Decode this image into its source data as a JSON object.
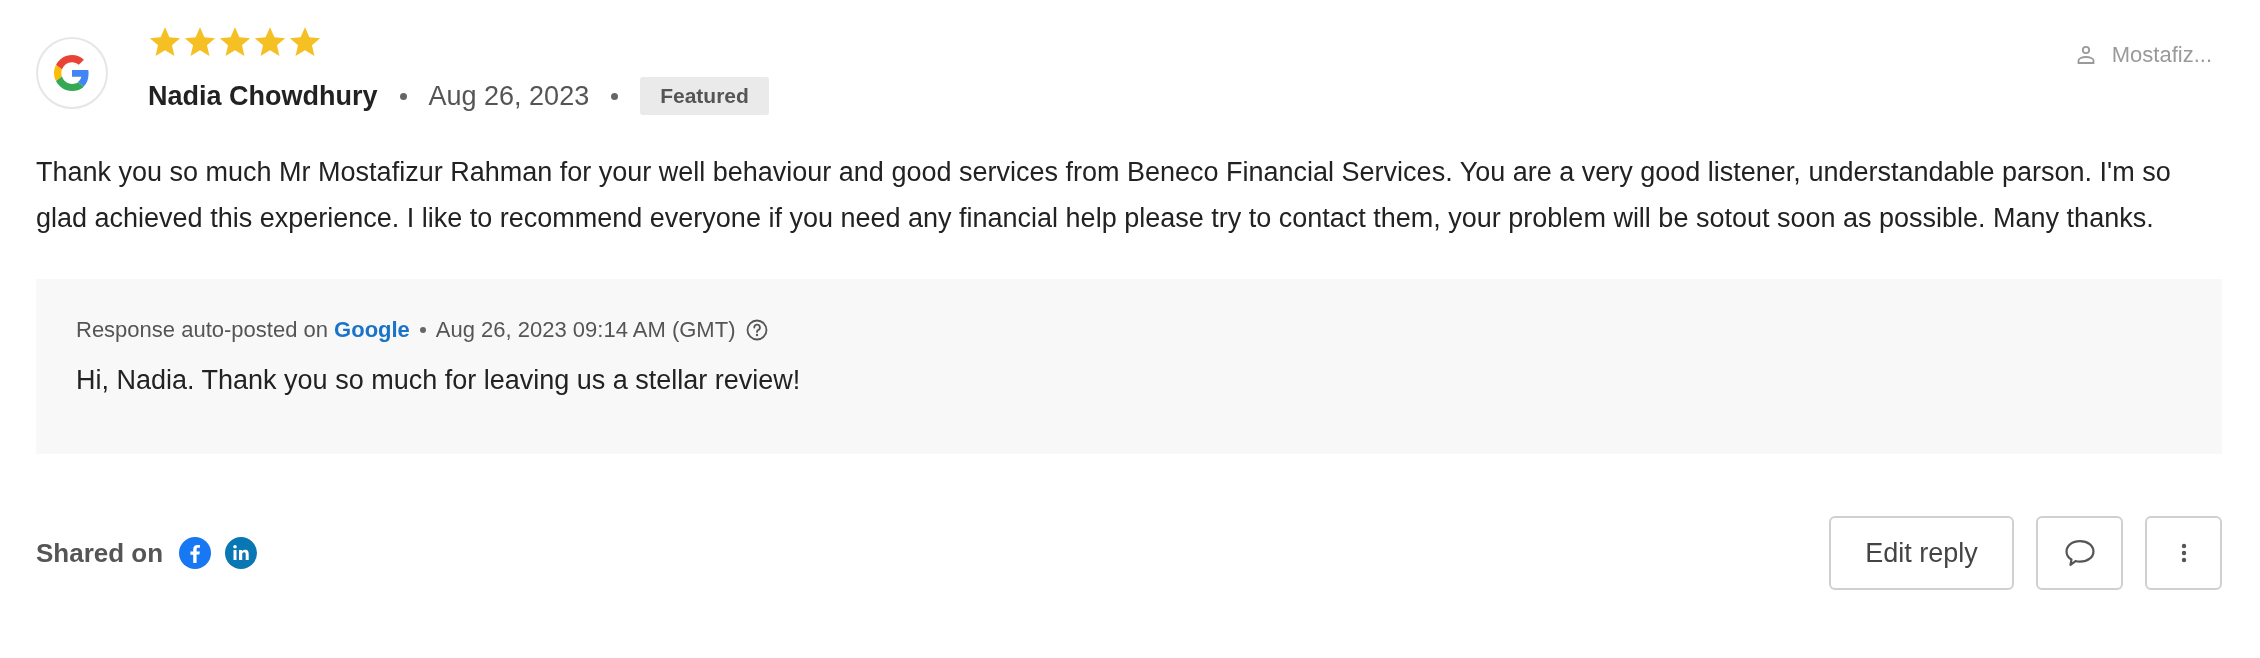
{
  "review": {
    "stars": 5,
    "reviewer": "Nadia Chowdhury",
    "date": "Aug 26, 2023",
    "badge": "Featured",
    "assignee": "Mostafiz...",
    "text": "Thank you so much Mr Mostafizur Rahman for your well behaviour and good services from Beneco Financial Services. You are a very good listener, understandable parson. I'm so glad achieved this experience. I like to recommend everyone if you need any financial help please try to contact them, your problem will be sotout soon as possible. Many thanks."
  },
  "response": {
    "prefix": "Response auto-posted on",
    "platform": "Google",
    "timestamp": "Aug 26, 2023 09:14 AM (GMT)",
    "text": "Hi, Nadia. Thank you so much for leaving us a stellar review!"
  },
  "footer": {
    "shared_label": "Shared on",
    "networks": [
      {
        "kind": "facebook"
      },
      {
        "kind": "linkedin"
      }
    ],
    "buttons": [
      {
        "kind": "text",
        "label": "Edit reply"
      },
      {
        "kind": "comment"
      },
      {
        "kind": "more"
      }
    ]
  }
}
